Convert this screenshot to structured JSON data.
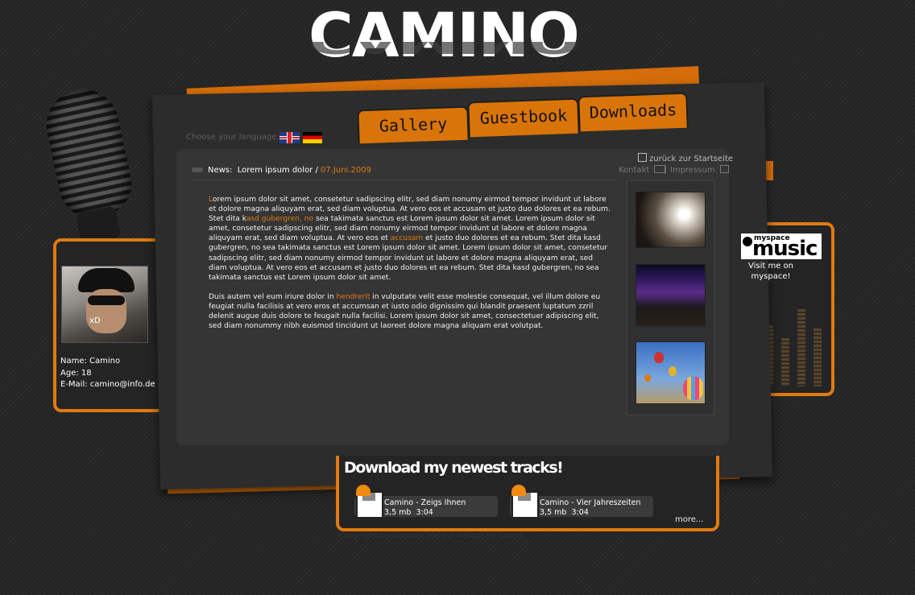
{
  "logo": {
    "title": "Camino"
  },
  "nav": {
    "tabs": [
      {
        "label": "Gallery"
      },
      {
        "label": "Guestbook"
      },
      {
        "label": "Downloads"
      }
    ]
  },
  "language": {
    "label": "Choose your language:",
    "flags": [
      "flag-uk-icon",
      "flag-de-icon"
    ]
  },
  "toplinks": {
    "back": "zurück zur Startseite",
    "kontakt": "Kontakt",
    "impressum": "Impressum"
  },
  "news": {
    "label": "News:",
    "title": "Lorem ipsum dolor /",
    "date": "07.Juni.2009"
  },
  "article": {
    "p1_a": "L",
    "p1_b": "orem ipsum dolor sit amet, consetetur sadipscing elitr, sed diam nonumy eirmod tempor invidunt ut labore et dolore magna aliquyam erat, sed diam voluptua. At vero eos et accusam et justo duo dolores et ea rebum. Stet dita k",
    "p1_link1": "asd gubergren, no",
    "p1_c": " sea takimata sanctus est Lorem ipsum dolor sit amet. Lorem ipsum dolor sit amet, consetetur sadipscing elitr, sed diam nonumy eirmod tempor invidunt ut labore et dolore magna aliquyam erat, sed diam voluptua. At vero eos et ",
    "p1_link2": "accusam",
    "p1_d": " et justo duo dolores et ea rebum. Stet dita kasd gubergren, no sea takimata sanctus est Lorem ipsum dolor sit amet. Lorem ipsum dolor sit amet, consetetur sadipscing elitr, sed diam nonumy eirmod tempor invidunt ut labore et dolore magna aliquyam erat, sed diam voluptua. At vero eos et accusam et justo duo dolores et ea rebum. Stet dita kasd gubergren, no sea takimata sanctus est Lorem ipsum dolor sit amet.",
    "p2_a": "Duis autem vel eum iriure dolor in ",
    "p2_link": "hendrerit",
    "p2_b": " in vulputate velit esse molestie consequat, vel illum dolore eu feugiat nulla facilisis at vero eros et accumsan et iusto odio dignissim qui blandit praesent luptatum zzril delenit augue duis dolore te feugait nulla facilisi. Lorem ipsum dolor sit amet, consectetuer adipiscing elit, sed diam nonummy nibh euismod tincidunt ut laoreet dolore magna aliquam erat volutpat."
  },
  "profile": {
    "avatar_caption": "xD",
    "name": "Name: Camino",
    "age": "Age: 18",
    "email": "E-Mail: camino@info.de"
  },
  "myspace": {
    "logo_small": "myspace",
    "logo_big": "music",
    "text": "Visit me on myspace!"
  },
  "downloads": {
    "title": "Download my newest tracks!",
    "tracks": [
      {
        "title": "Camino - Zeigs Ihnen",
        "meta": "3,5 mb  3:04"
      },
      {
        "title": "Camino - Vier Jahreszeiten",
        "meta": "3,5 mb  3:04"
      }
    ],
    "more": "more..."
  },
  "footer": {
    "copyright": "Copyright by Camino 2009 // design by Crypd"
  },
  "colors": {
    "accent": "#e07a10",
    "background": "#262626",
    "panel": "#353535"
  }
}
